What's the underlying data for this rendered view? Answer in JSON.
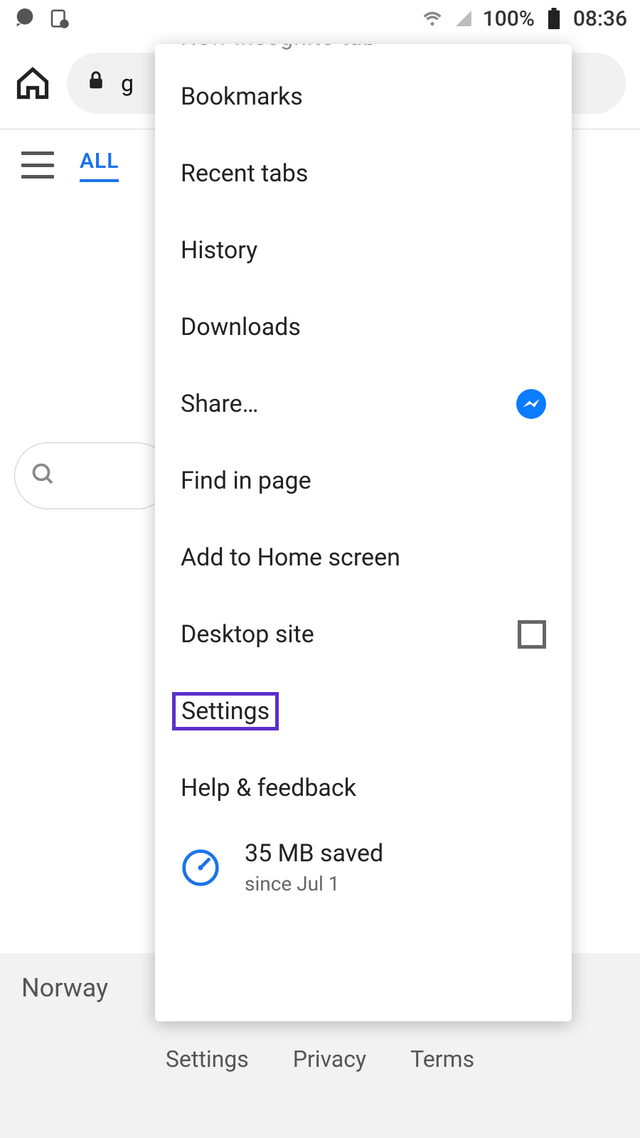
{
  "status": {
    "battery_pct": "100%",
    "time": "08:36"
  },
  "toolbar": {
    "url_partial": "g"
  },
  "tabs": {
    "all_label": "ALL"
  },
  "menu": {
    "new_incognito": "New incognito tab",
    "bookmarks": "Bookmarks",
    "recent_tabs": "Recent tabs",
    "history": "History",
    "downloads": "Downloads",
    "share": "Share…",
    "find_in_page": "Find in page",
    "add_home": "Add to Home screen",
    "desktop_site": "Desktop site",
    "settings": "Settings",
    "help": "Help & feedback",
    "data_saved_amount": "35 MB saved",
    "data_saved_since": "since Jul 1"
  },
  "footer": {
    "location": "Norway",
    "settings": "Settings",
    "privacy": "Privacy",
    "terms": "Terms"
  }
}
